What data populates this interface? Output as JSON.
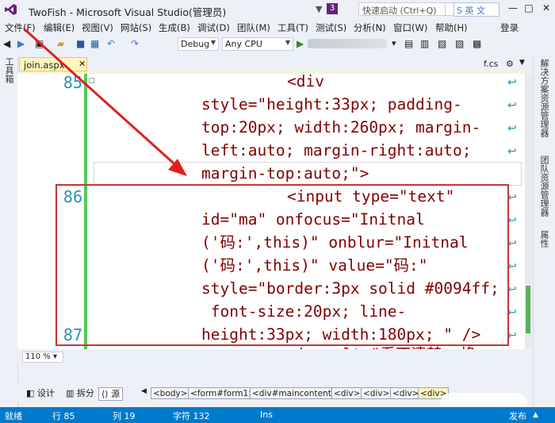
{
  "titlebar": {
    "app_title": "TwoFish - Microsoft Visual Studio(管理员)",
    "notification_count": "3",
    "quick_launch_placeholder": "快速启动 (Ctrl+Q)",
    "ime_label": "英 文"
  },
  "menu": {
    "items": [
      "文件(F)",
      "编辑(E)",
      "视图(V)",
      "网站(S)",
      "生成(B)",
      "调试(D)",
      "团队(M)",
      "工具(T)",
      "测试(S)",
      "分析(N)",
      "窗口(W)",
      "帮助(H)"
    ],
    "login": "登录"
  },
  "toolbar": {
    "config": "Debug",
    "platform": "Any CPU"
  },
  "left_panel": {
    "label": "工具箱"
  },
  "tabs": {
    "active": "join.aspx",
    "other": "f.cs"
  },
  "editor": {
    "lines": [
      {
        "number": "85",
        "text": "<div"
      },
      {
        "number": "",
        "text": "style=\"height:33px; padding-"
      },
      {
        "number": "",
        "text": "top:20px; width:260px; margin-"
      },
      {
        "number": "",
        "text": "left:auto; margin-right:auto;"
      },
      {
        "number": "",
        "text": "margin-top:auto;\">"
      },
      {
        "number": "86",
        "text": "<input type=\"text\""
      },
      {
        "number": "",
        "text": "id=\"ma\" onfocus=\"Initnal"
      },
      {
        "number": "",
        "text": "('码:',this)\" onblur=\"Initnal"
      },
      {
        "number": "",
        "text": "('码:',this)\" value=\"码:\""
      },
      {
        "number": "",
        "text": "style=\"border:3px solid #0094ff;"
      },
      {
        "number": "",
        "text": " font-size:20px; line-"
      },
      {
        "number": "",
        "text": "height:33px; width:180px; \" />"
      },
      {
        "number": "87",
        "text": "<img alt=\"看不清楚, 换"
      }
    ]
  },
  "right_panel": {
    "labels": [
      "解决方案资源管理器",
      "团队资源管理器",
      "属性"
    ]
  },
  "zoom": "110 %",
  "view_buttons": {
    "design": "设计",
    "split": "拆分",
    "source": "源"
  },
  "breadcrumbs": [
    "<body>",
    "<form#form1>",
    "<div#maincontent>",
    "<div>",
    "<div>",
    "<div>",
    "<div>"
  ],
  "status": {
    "ready": "就绪",
    "line": "行 85",
    "col": "列 19",
    "char": "字符 132",
    "mode": "Ins",
    "publish": "发布"
  },
  "colors": {
    "status_bar": "#007acc",
    "annotation_red": "#cc3333",
    "line_number": "#2b91af",
    "tag": "#800000",
    "attr": "#ff0000",
    "value": "#0000ff"
  }
}
